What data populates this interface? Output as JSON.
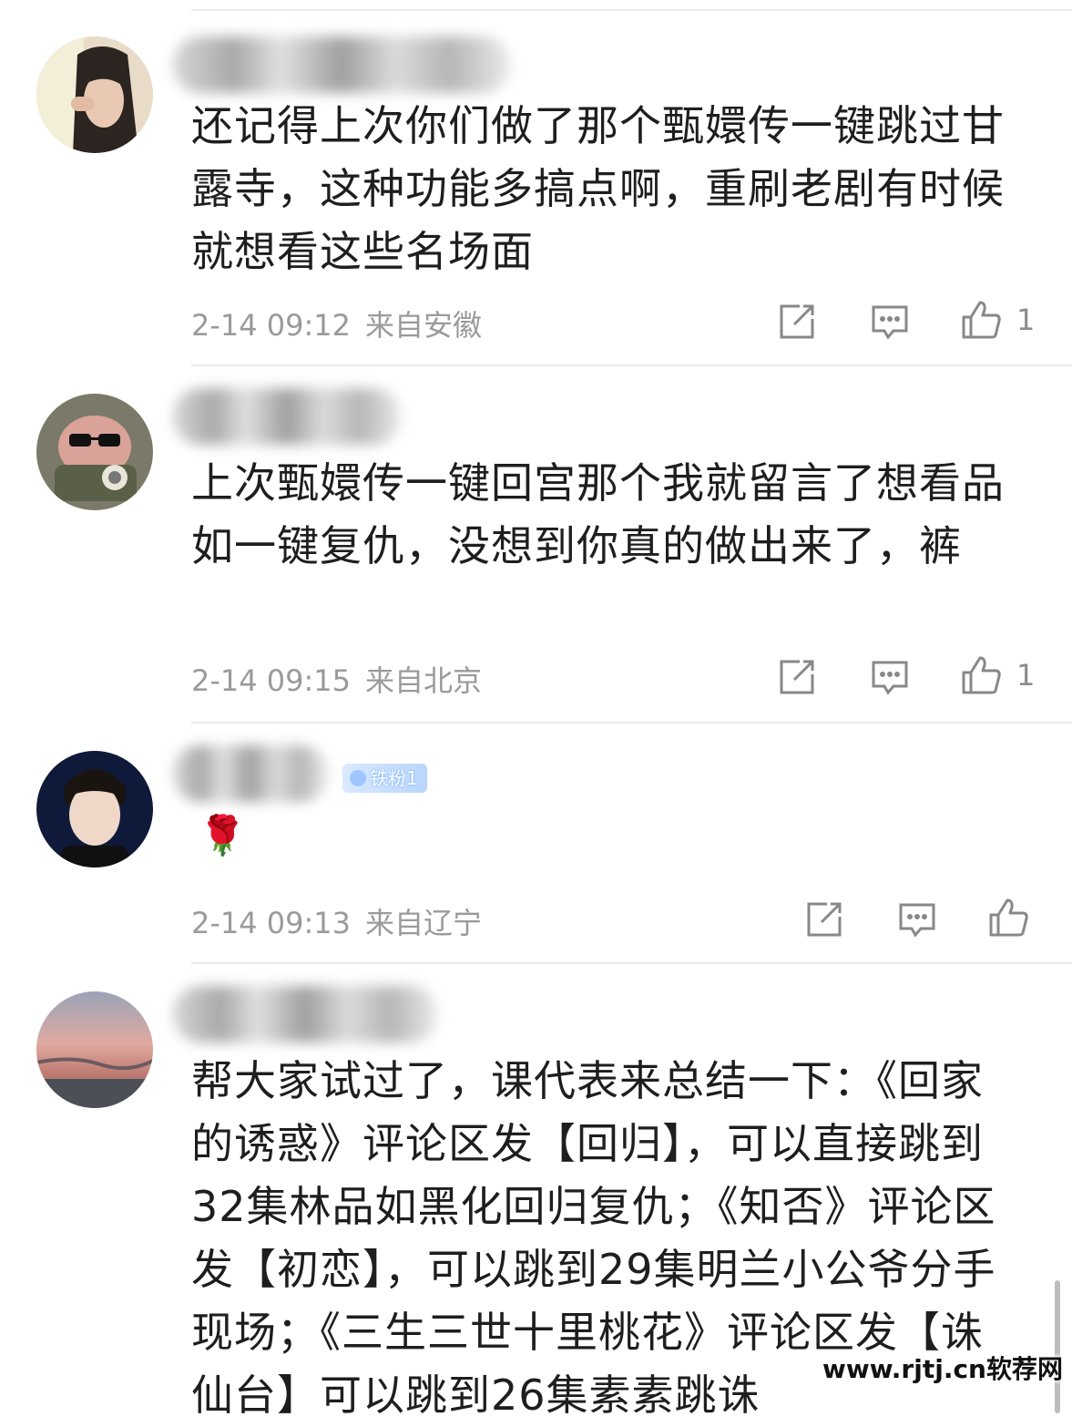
{
  "comments": [
    {
      "text": "还记得上次你们做了那个甄嬛传一键跳过甘露寺，这种功能多搞点啊，重刷老剧有时候就想看这些名场面",
      "time": "2-14 09:12",
      "location": "来自安徽",
      "likes": "1"
    },
    {
      "text": "上次甄嬛传一键回宫那个我就留言了想看品如一键复仇，没想到你真的做出来了，裤",
      "time": "2-14 09:15",
      "location": "来自北京",
      "likes": "1"
    },
    {
      "badge": "铁粉1",
      "text": "🌹",
      "time": "2-14 09:13",
      "location": "来自辽宁",
      "likes": ""
    },
    {
      "text": "帮大家试过了，课代表来总结一下：《回家的诱惑》评论区发【回归】，可以直接跳到32集林品如黑化回归复仇；《知否》评论区发【初恋】，可以跳到29集明兰小公爷分手现场；《三生三世十里桃花》评论区发【诛仙台】可以跳到26集素素跳诛"
    }
  ],
  "icons": {
    "share": "share-icon",
    "comment": "comment-icon",
    "like": "thumbs-up-icon"
  },
  "watermark": "www.rjtj.cn软荐网"
}
